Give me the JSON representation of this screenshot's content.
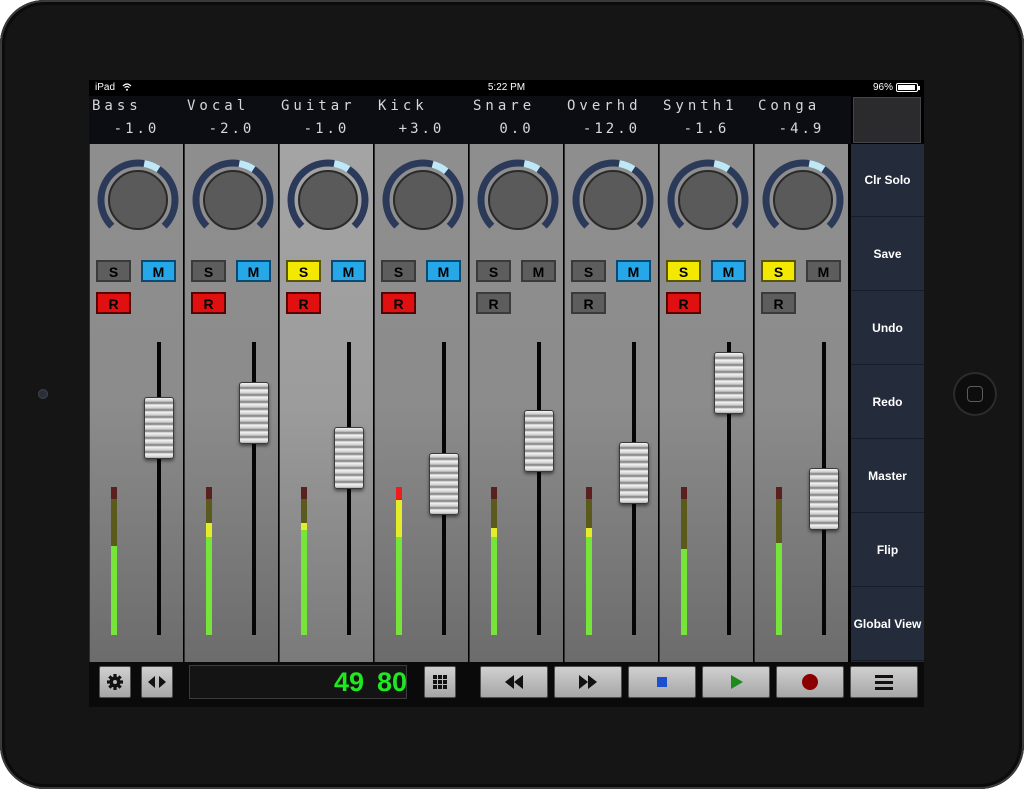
{
  "device": {
    "status_left": "iPad",
    "status_time": "5:22 PM",
    "status_battery": "96%"
  },
  "channels": [
    {
      "name": "Bass",
      "value": "-1.0",
      "solo": false,
      "mute": true,
      "record": true,
      "knob_level": 0.58,
      "fader_level": 0.7,
      "meter_green": 0.6,
      "meter_yellow": 0.0
    },
    {
      "name": "Vocal",
      "value": "-2.0",
      "solo": false,
      "mute": true,
      "record": true,
      "knob_level": 0.58,
      "fader_level": 0.76,
      "meter_green": 0.66,
      "meter_yellow": 0.1
    },
    {
      "name": "Guitar",
      "value": "-1.0",
      "solo": true,
      "mute": true,
      "record": true,
      "knob_level": 0.58,
      "fader_level": 0.58,
      "meter_green": 0.71,
      "meter_yellow": 0.05
    },
    {
      "name": "Kick",
      "value": "+3.0",
      "solo": false,
      "mute": true,
      "record": true,
      "knob_level": 0.6,
      "fader_level": 0.48,
      "meter_green": 0.66,
      "meter_yellow": 0.25,
      "meter_red": true
    },
    {
      "name": "Snare",
      "value": "0.0",
      "solo": false,
      "mute": false,
      "record": false,
      "knob_level": 0.58,
      "fader_level": 0.65,
      "meter_green": 0.66,
      "meter_yellow": 0.06
    },
    {
      "name": "Overhd",
      "value": "-12.0",
      "solo": false,
      "mute": true,
      "record": false,
      "knob_level": 0.58,
      "fader_level": 0.52,
      "meter_green": 0.66,
      "meter_yellow": 0.06
    },
    {
      "name": "Synth1",
      "value": "-1.6",
      "solo": true,
      "mute": true,
      "record": true,
      "knob_level": 0.58,
      "fader_level": 0.88,
      "meter_green": 0.58,
      "meter_yellow": 0.0
    },
    {
      "name": "Conga",
      "value": "-4.9",
      "solo": true,
      "mute": false,
      "record": false,
      "knob_level": 0.58,
      "fader_level": 0.42,
      "meter_green": 0.62,
      "meter_yellow": 0.0
    }
  ],
  "labels": {
    "solo": "S",
    "mute": "M",
    "record": "R"
  },
  "sidebar": [
    "Clr Solo",
    "Save",
    "Undo",
    "Redo",
    "Master",
    "Flip",
    "Global View"
  ],
  "counter": {
    "bars": "49",
    "beats": "80"
  },
  "toolbar_icons": [
    "gear-icon",
    "left-right-arrows-icon",
    "grid-icon",
    "rewind-icon",
    "fast-forward-icon",
    "stop-icon",
    "play-icon",
    "record-icon",
    "menu-icon"
  ],
  "colors": {
    "solo_on": "#f2e800",
    "mute_on": "#26a8e8",
    "record_on": "#e01010",
    "button_off": "#5d5d5d",
    "meter_green": "#77e43a",
    "meter_yellow": "#e4ee28",
    "meter_red": "#ee1c1c",
    "counter_text": "#1fe81f",
    "knob_ring": "#2c3a5a",
    "knob_accent": "#bfe8f6"
  }
}
